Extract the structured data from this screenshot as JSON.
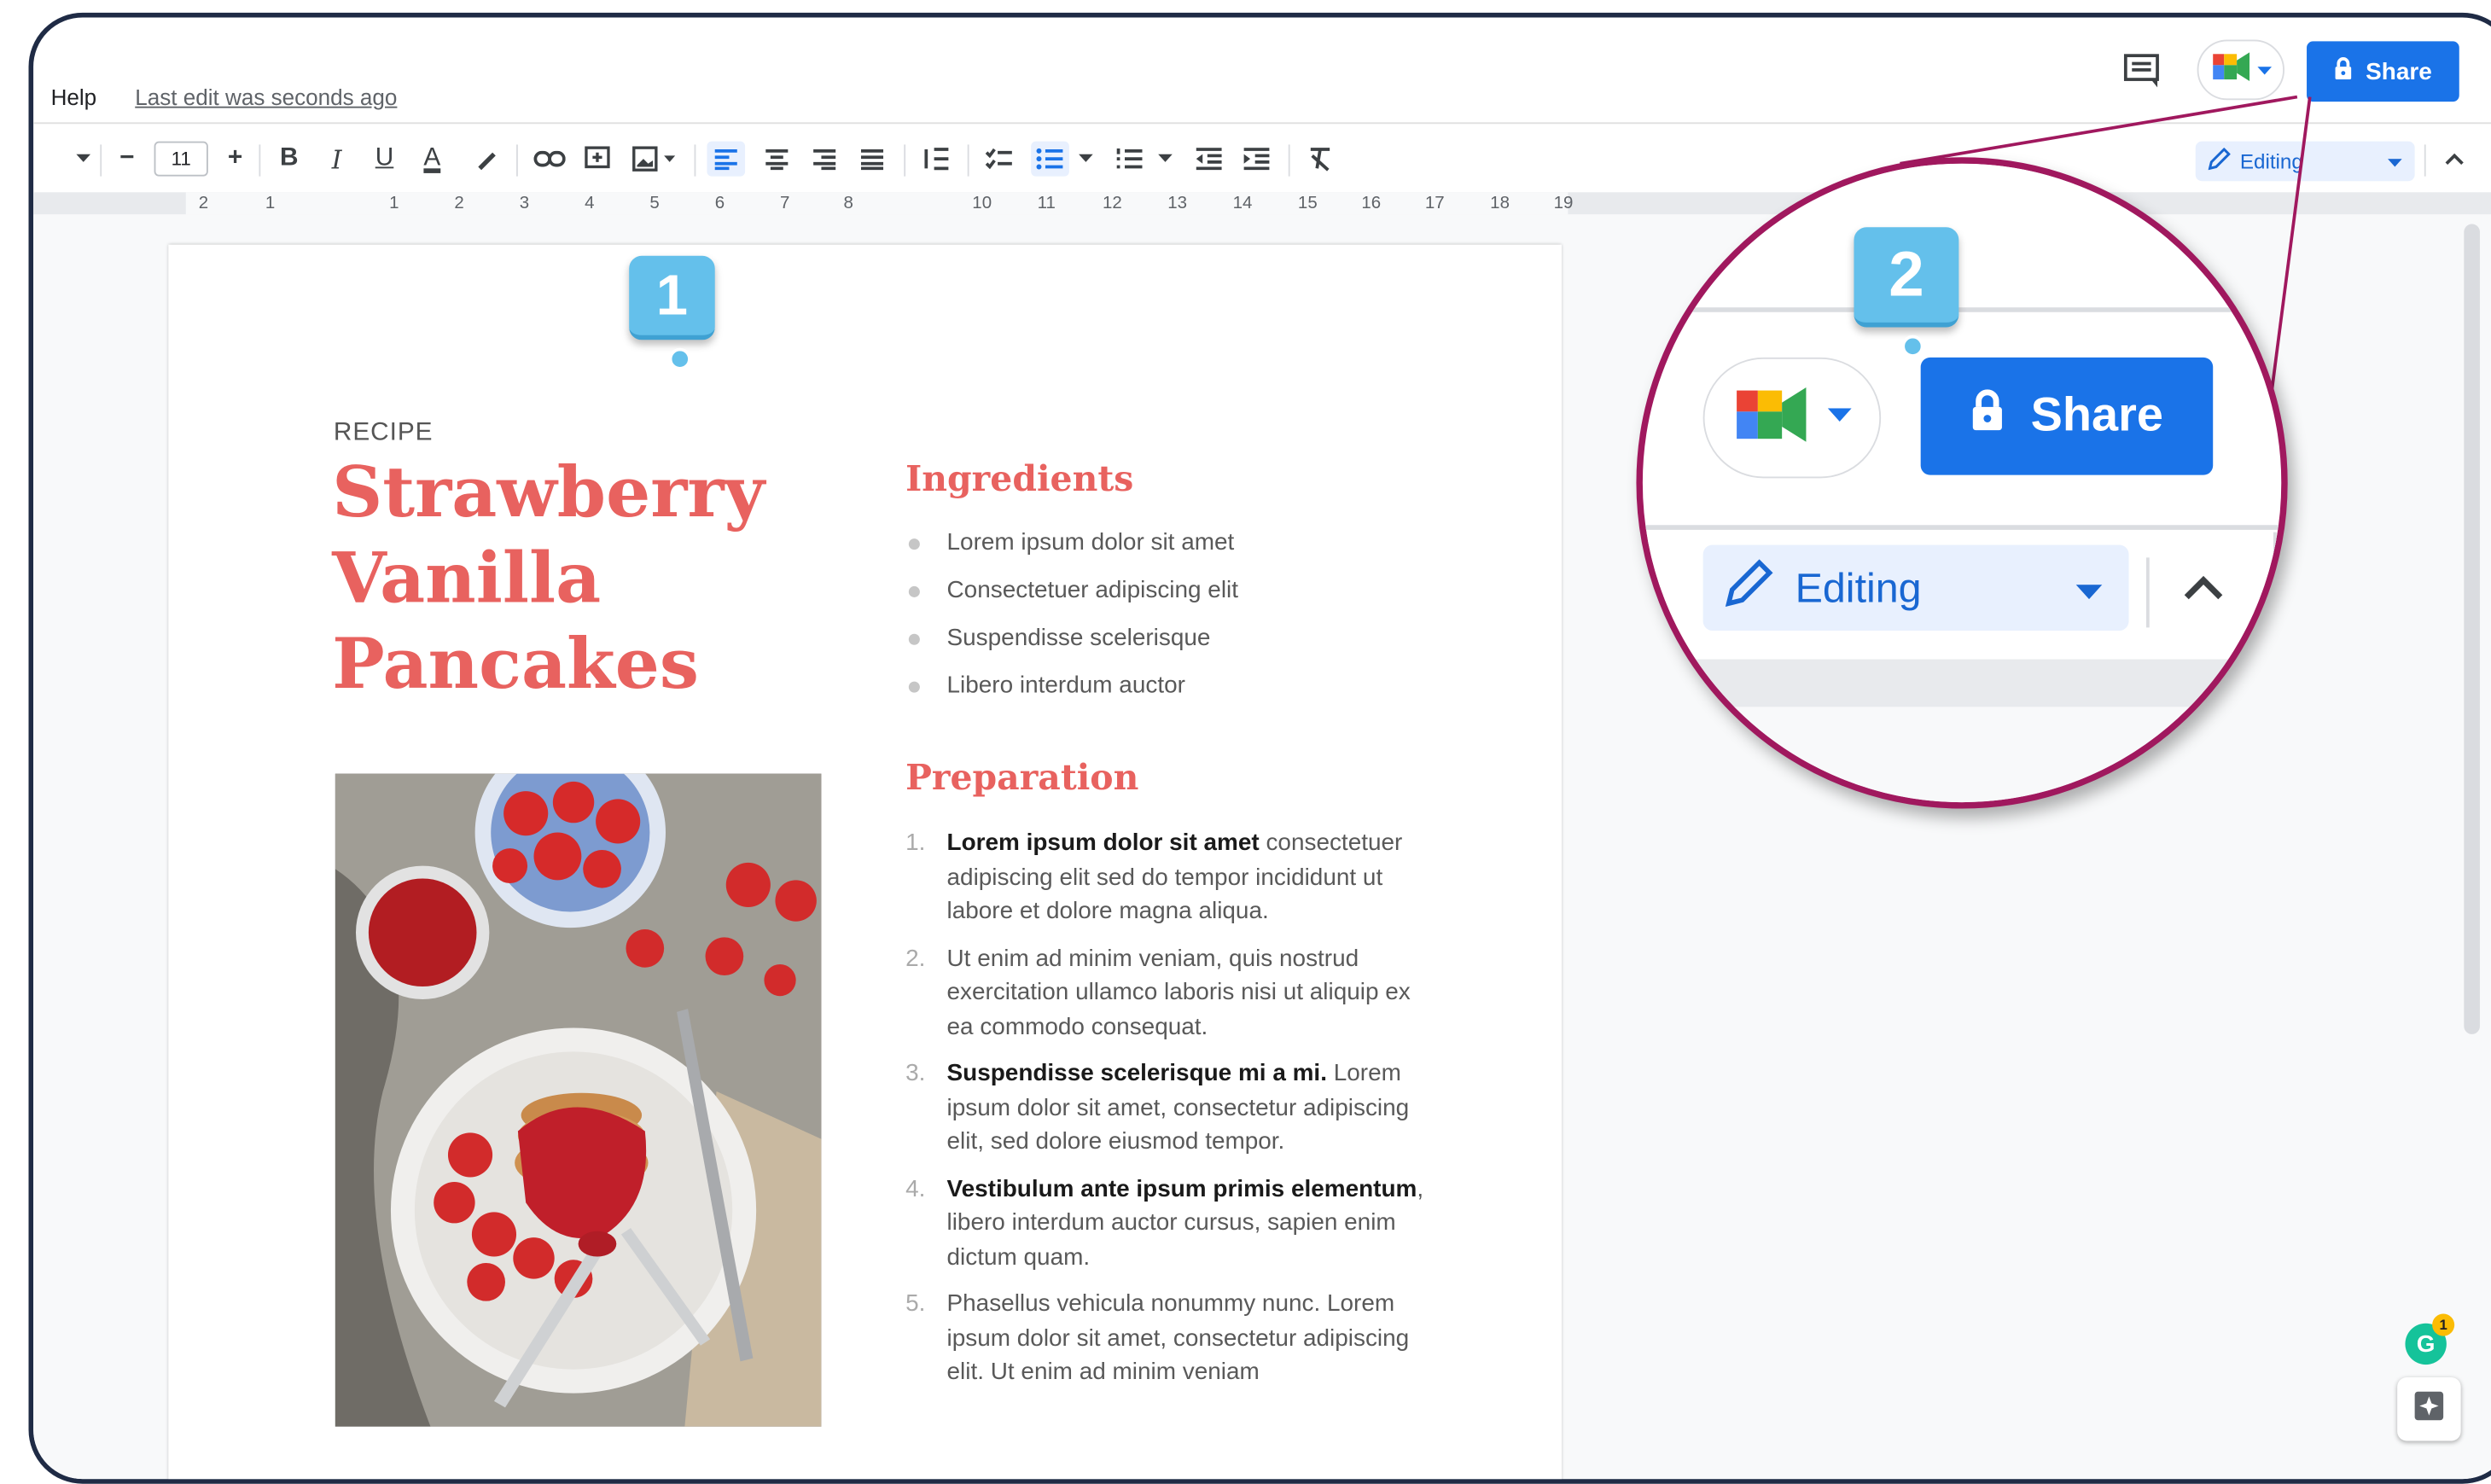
{
  "menu": {
    "help": "Help",
    "last_edit": "Last edit was seconds ago"
  },
  "topbar": {
    "share_label": "Share",
    "comment_icon": "comment-icon",
    "meet_icon": "google-meet-icon"
  },
  "toolbar": {
    "minus": "−",
    "font_size": "11",
    "plus": "+",
    "bold": "B",
    "italic": "I",
    "underline": "U",
    "text_color": "A",
    "editing_label": "Editing"
  },
  "ruler": {
    "labels": [
      "2",
      "1",
      "1",
      "2",
      "3",
      "4",
      "5",
      "6",
      "7",
      "8",
      "10",
      "11",
      "12",
      "13",
      "14",
      "15",
      "16",
      "17",
      "18",
      "19"
    ]
  },
  "document": {
    "recipe_label": "RECIPE",
    "title": "Strawberry Vanilla Pancakes",
    "ingredients_heading": "Ingredients",
    "ingredients": [
      "Lorem ipsum dolor sit amet",
      "Consectetuer adipiscing elit",
      "Suspendisse scelerisque",
      "Libero interdum auctor"
    ],
    "preparation_heading": "Preparation",
    "steps": [
      {
        "num": "1.",
        "bold": "Lorem ipsum dolor sit amet",
        "text": " consectetuer adipiscing elit sed do tempor incididunt ut labore et dolore magna aliqua."
      },
      {
        "num": "2.",
        "bold": "",
        "text": "Ut enim ad minim veniam, quis nostrud exercitation ullamco laboris nisi ut aliquip ex ea commodo consequat."
      },
      {
        "num": "3.",
        "bold": "Suspendisse scelerisque mi a mi.",
        "text": " Lorem ipsum dolor sit amet, consectetur adipiscing elit, sed dolore eiusmod tempor."
      },
      {
        "num": "4.",
        "bold": "Vestibulum ante ipsum primis elementum",
        "text": ", libero interdum auctor cursus, sapien enim dictum quam."
      },
      {
        "num": "5.",
        "bold": "",
        "text": "Phasellus vehicula nonummy nunc. Lorem ipsum dolor sit amet, consectetur adipiscing elit. Ut enim ad minim veniam"
      }
    ]
  },
  "callouts": {
    "one": "1",
    "two": "2"
  },
  "zoom": {
    "share_label": "Share",
    "editing_label": "Editing"
  },
  "widgets": {
    "grammarly_letter": "G",
    "grammarly_badge": "1"
  },
  "colors": {
    "accent_red": "#e8625f",
    "share_blue": "#1a73e8",
    "callout_blue": "#64c0eb",
    "zoom_ring": "#a0185e"
  }
}
